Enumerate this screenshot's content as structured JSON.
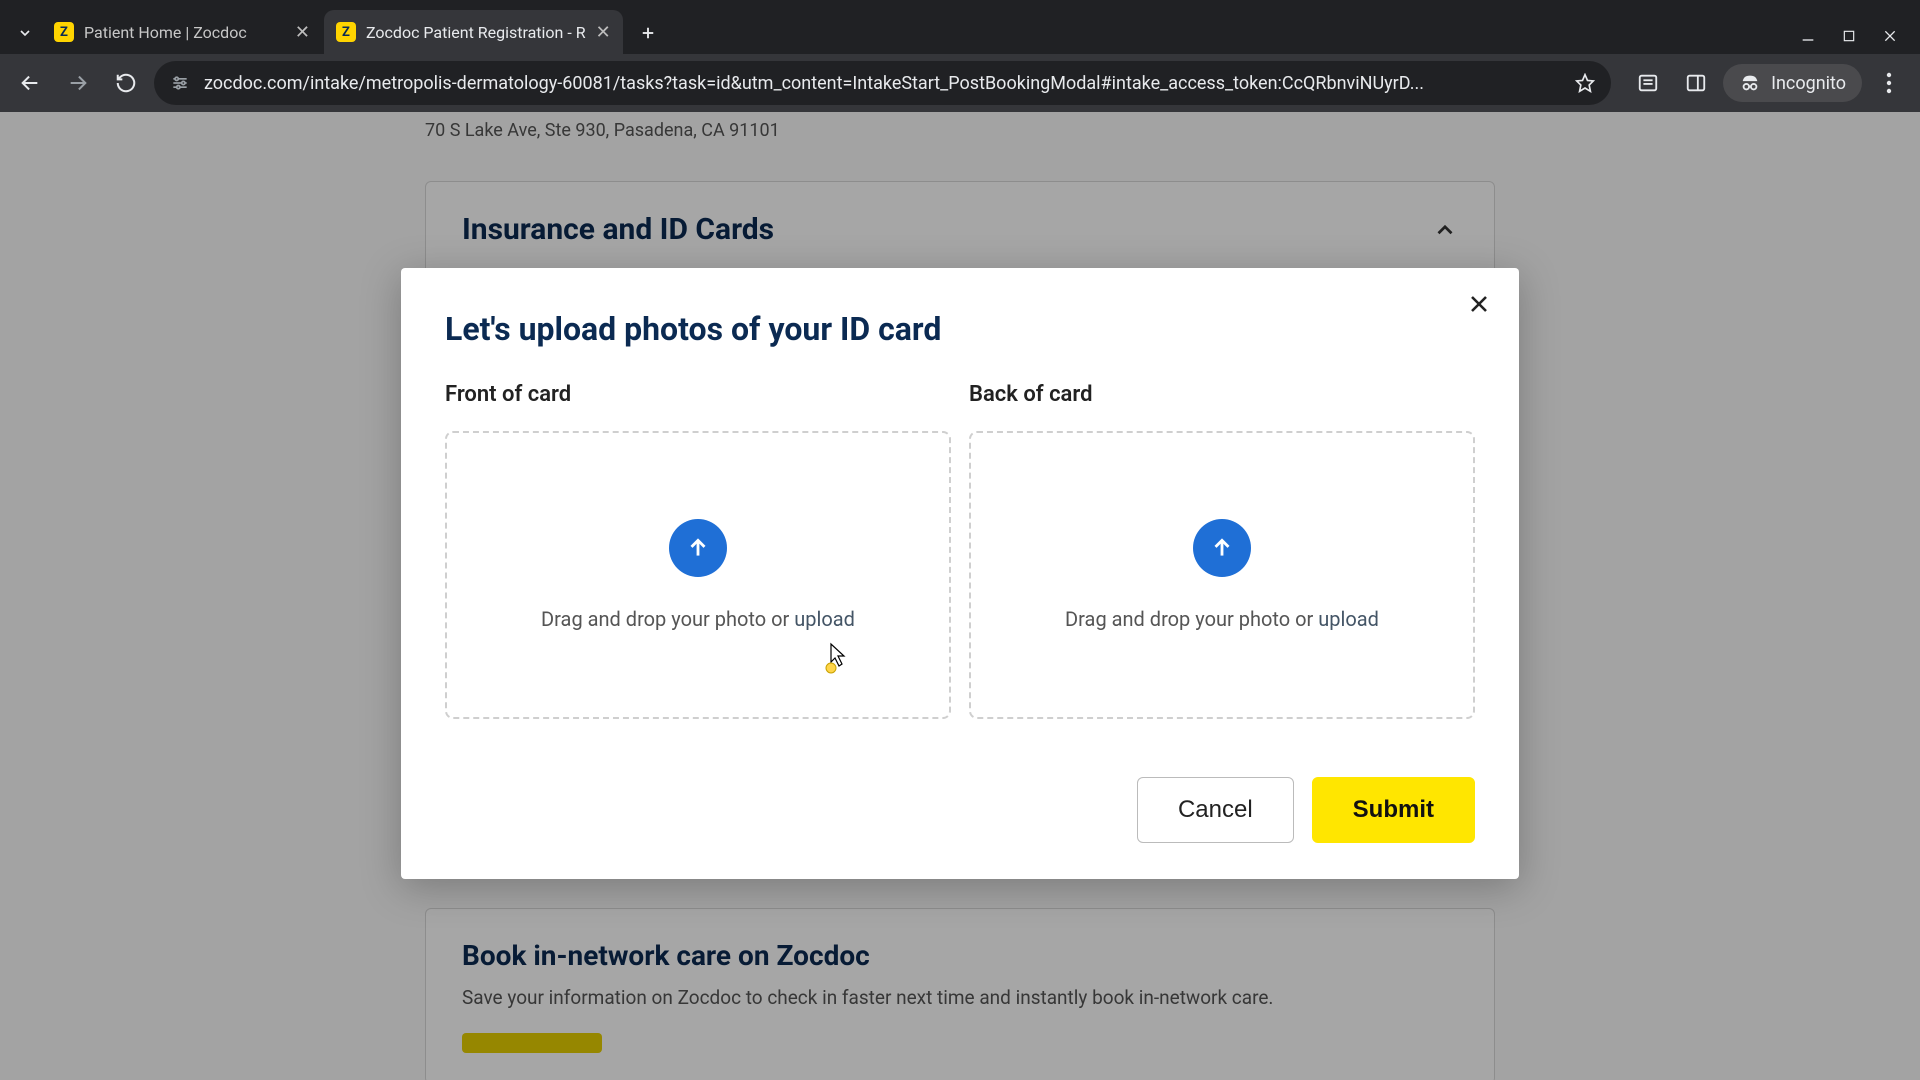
{
  "browser": {
    "tabs": [
      {
        "title": "Patient Home | Zocdoc",
        "favicon_letter": "Z",
        "active": false
      },
      {
        "title": "Zocdoc Patient Registration - R",
        "favicon_letter": "Z",
        "active": true
      }
    ],
    "url": "zocdoc.com/intake/metropolis-dermatology-60081/tasks?task=id&utm_content=IntakeStart_PostBookingModal#intake_access_token:CcQRbnviNUyrD...",
    "incognito_label": "Incognito"
  },
  "page": {
    "clinic_address": "70 S Lake Ave, Ste 930, Pasadena, CA 91101",
    "section_title": "Insurance and ID Cards",
    "book_card": {
      "title": "Book in-network care on Zocdoc",
      "subtitle": "Save your information on Zocdoc to check in faster next time and instantly book in-network care."
    }
  },
  "modal": {
    "title": "Let's upload photos of your ID card",
    "front_label": "Front of card",
    "back_label": "Back of card",
    "drop_prefix": "Drag and drop your photo or ",
    "drop_link": "upload",
    "cancel": "Cancel",
    "submit": "Submit"
  }
}
